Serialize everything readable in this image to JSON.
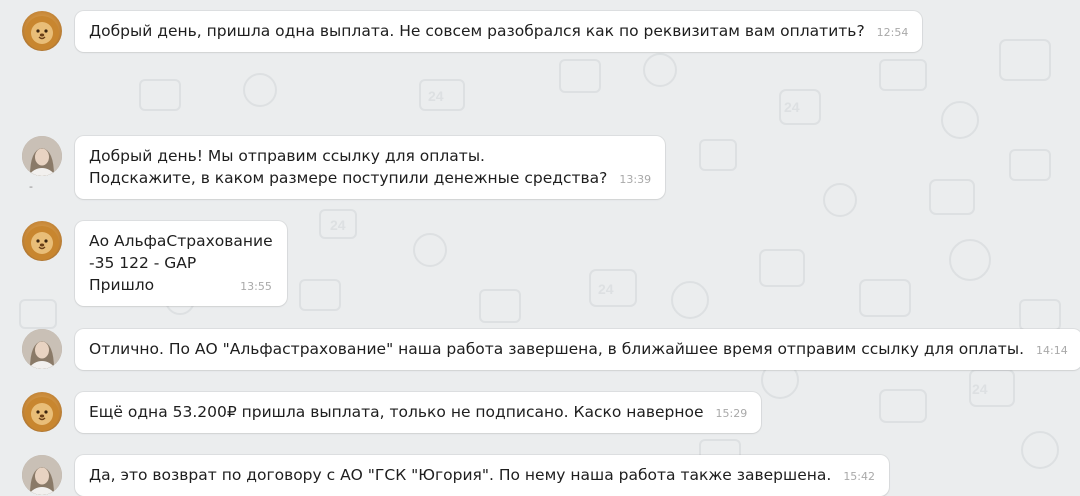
{
  "messages": [
    {
      "sender": "client",
      "avatar": "lion-avatar",
      "lines": [
        "Добрый день, пришла одна выплата. Не совсем разобрался как по реквизитам вам оплатить?"
      ],
      "time": "12:54"
    },
    {
      "sender": "manager",
      "avatar": "woman-avatar",
      "lines": [
        "Добрый день! Мы отправим ссылку для оплаты.",
        "Подскажите, в каком размере поступили денежные средства?"
      ],
      "time": "13:39",
      "avatar_caption": "-"
    },
    {
      "sender": "client",
      "avatar": "lion-avatar",
      "lines": [
        "Ао АльфаСтрахование",
        "-35 122 - GAP",
        "Пришло"
      ],
      "time": "13:55"
    },
    {
      "sender": "manager",
      "avatar": "woman-avatar",
      "lines": [
        "Отлично. По АО \"Альфастрахование\" наша работа завершена, в ближайшее время отправим ссылку для оплаты."
      ],
      "time": "14:14"
    },
    {
      "sender": "client",
      "avatar": "lion-avatar",
      "lines": [
        "Ещё одна 53.200₽ пришла выплата, только не подписано. Каско наверное"
      ],
      "time": "15:29"
    },
    {
      "sender": "manager",
      "avatar": "woman-avatar",
      "lines": [
        "Да, это возврат по договору с АО \"ГСК \"Югория\". По нему наша работа также завершена."
      ],
      "time": "15:42"
    }
  ],
  "colors": {
    "background": "#ebedee",
    "bubble": "#ffffff",
    "text": "#1e1e1e",
    "time": "#a9a9a9",
    "pattern": "#dfe2e4"
  }
}
